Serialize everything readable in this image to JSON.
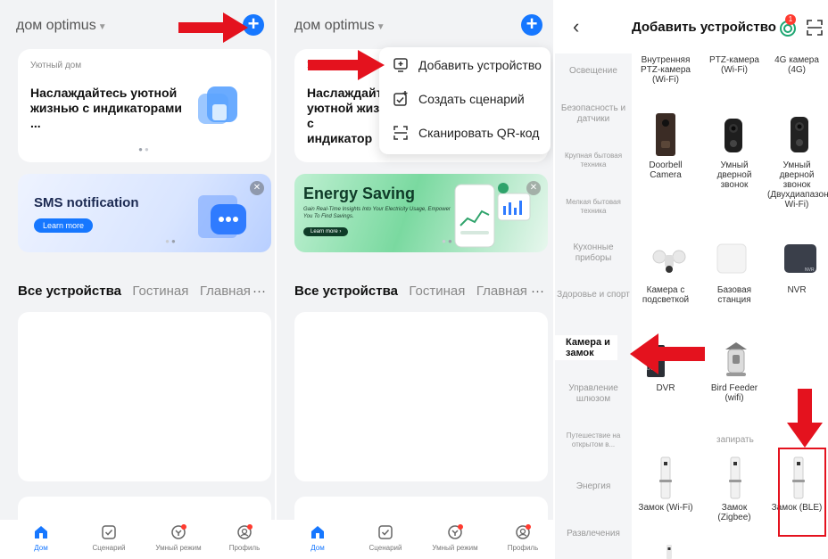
{
  "colors": {
    "accent": "#1677ff",
    "arrow": "#e4121e",
    "badge": "#ff3b30"
  },
  "panel1": {
    "home_name": "дом optimus",
    "cozy_card": {
      "small": "Уютный дом",
      "title": "Наслаждайтесь уютной жизнью с индикаторами ..."
    },
    "sms_banner": {
      "title": "SMS notification",
      "button": "Learn more"
    },
    "tabs": [
      "Все устройства",
      "Гостиная",
      "Главная"
    ],
    "more": "···"
  },
  "panel2": {
    "home_name": "дом optimus",
    "cozy_card": {
      "small": "У",
      "title": "Наслаждайт уютной жиз с индикатор"
    },
    "energy_banner": {
      "title": "Energy Saving",
      "sub": "Gain Real-Time Insights Into Your Electricity Usage, Empower You To Find Savings.",
      "button": "Learn more ›"
    },
    "menu": [
      {
        "label": "Добавить устройство",
        "icon": "add-device-icon"
      },
      {
        "label": "Создать сценарий",
        "icon": "create-scene-icon"
      },
      {
        "label": "Сканировать QR-код",
        "icon": "scan-icon"
      }
    ],
    "tabs": [
      "Все устройства",
      "Гостиная",
      "Главная"
    ],
    "more": "···"
  },
  "bottom_nav": [
    "Дом",
    "Сценарий",
    "Умный режим",
    "Профиль"
  ],
  "panel3": {
    "title": "Добавить устройство",
    "badge": "1",
    "categories": [
      "Освещение",
      "Безопасность и датчики",
      "Крупная бытовая техника",
      "Мелкая бытовая техника",
      "Кухонные приборы",
      "Здоровье и спорт",
      "Камера и замок",
      "Управление шлюзом",
      "Путешествие на открытом в...",
      "Энергия",
      "Развлечения"
    ],
    "row1": [
      "Внутренняя PTZ-камера (Wi-Fi)",
      "PTZ-камера (Wi-Fi)",
      "4G камера (4G)"
    ],
    "row2": [
      "Doorbell Camera",
      "Умный дверной звонок",
      "Умный дверной звонок (Двухдиапазонный Wi-Fi)"
    ],
    "row3": [
      "Камера с подсветкой",
      "Базовая станция",
      "NVR"
    ],
    "row4": [
      "DVR",
      "Bird Feeder (wifi)"
    ],
    "nvr_tag": "NVR",
    "dvr_tag": "DVR",
    "section_lock": "запирать",
    "row5": [
      "Замок (Wi-Fi)",
      "Замок (Zigbee)",
      "Замок (BLE)"
    ]
  }
}
